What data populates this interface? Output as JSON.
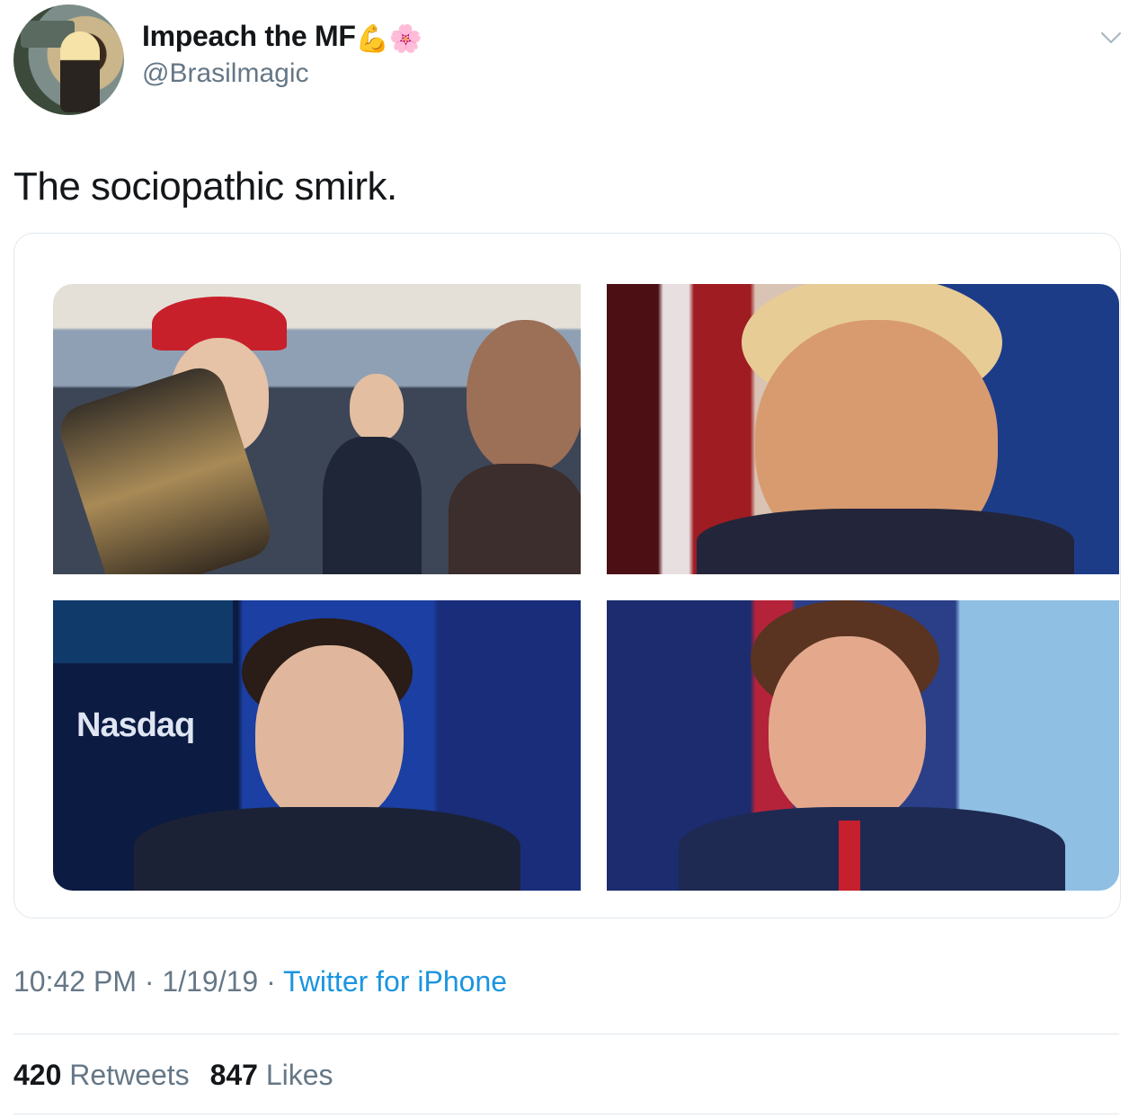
{
  "tweet": {
    "display_name": "Impeach the MF",
    "name_emoji_1": "💪",
    "name_emoji_2": "🌸",
    "handle": "@Brasilmagic",
    "text": "The sociopathic smirk.",
    "media_overlay_text": "Nasdaq",
    "time": "10:42 PM",
    "date": "1/19/19",
    "separator": " · ",
    "source": "Twitter for iPhone",
    "retweets_count": "420",
    "retweets_label": "Retweets",
    "likes_count": "847",
    "likes_label": "Likes"
  },
  "icons": {
    "menu": "chevron-down-icon"
  },
  "colors": {
    "primary_text": "#14171a",
    "secondary_text": "#657786",
    "link": "#1b95e0",
    "divider": "#e1e8ed"
  }
}
